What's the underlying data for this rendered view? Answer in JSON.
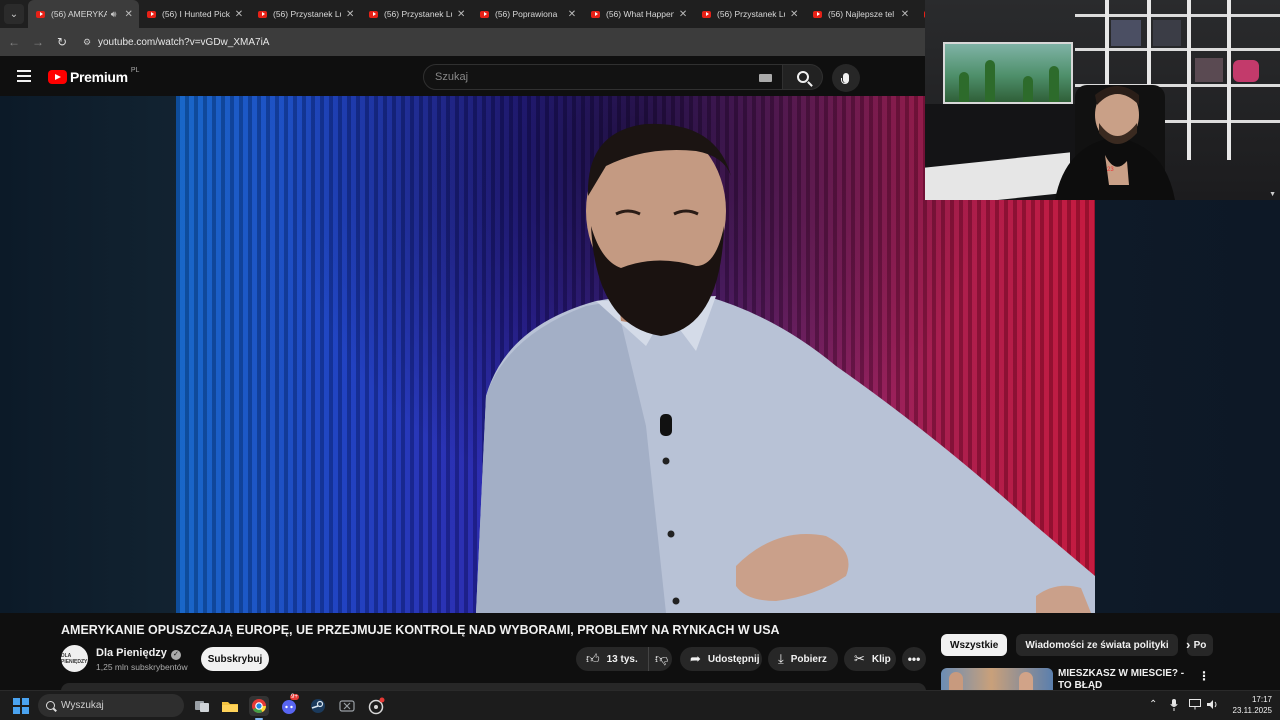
{
  "browser": {
    "tabs": [
      {
        "title": "(56) AMERYKAN",
        "active": true,
        "audio": true
      },
      {
        "title": "(56) I Hunted Pick",
        "active": false,
        "audio": false
      },
      {
        "title": "(56) Przystanek Lu",
        "active": false,
        "audio": false
      },
      {
        "title": "(56) Przystanek Lu",
        "active": false,
        "audio": false
      },
      {
        "title": "(56) Poprawiona",
        "active": false,
        "audio": false
      },
      {
        "title": "(56) What Happen",
        "active": false,
        "audio": false
      },
      {
        "title": "(56) Przystanek Lu",
        "active": false,
        "audio": false
      },
      {
        "title": "(56) Najlepsze tel",
        "active": false,
        "audio": false
      }
    ],
    "url": "youtube.com/watch?v=vGDw_XMA7iA"
  },
  "youtube": {
    "logo_word": "Premium",
    "country_code": "PL",
    "search_placeholder": "Szukaj"
  },
  "video": {
    "title": "AMERYKANIE OPUSZCZAJĄ EUROPĘ, UE PRZEJMUJE KONTROLĘ NAD WYBORAMI, PROBLEMY NA RYNKACH W USA",
    "channel": {
      "name": "Dla Pieniędzy",
      "subscribers": "1,25 mln subskrybentów",
      "avatar_text": "DLA PIENIĘDZY"
    },
    "actions": {
      "subscribe": "Subskrybuj",
      "likes": "13 tys.",
      "share": "Udostępnij",
      "download": "Pobierz",
      "clip": "Klip"
    }
  },
  "sidebar": {
    "chips": [
      "Wszystkie",
      "Wiadomości ze świata polityki",
      "Po"
    ],
    "recommendation": {
      "title": "MIESZKASZ W MIEŚCIE? - TO BŁĄD"
    }
  },
  "taskbar": {
    "search_placeholder": "Wyszukaj",
    "time": "17:17",
    "date": "23.11.2025",
    "discord_badge": "9+"
  },
  "colors": {
    "youtube_red": "#ff0000",
    "windows_blue": "#4aa3f0",
    "background": "#0f0f0f"
  }
}
